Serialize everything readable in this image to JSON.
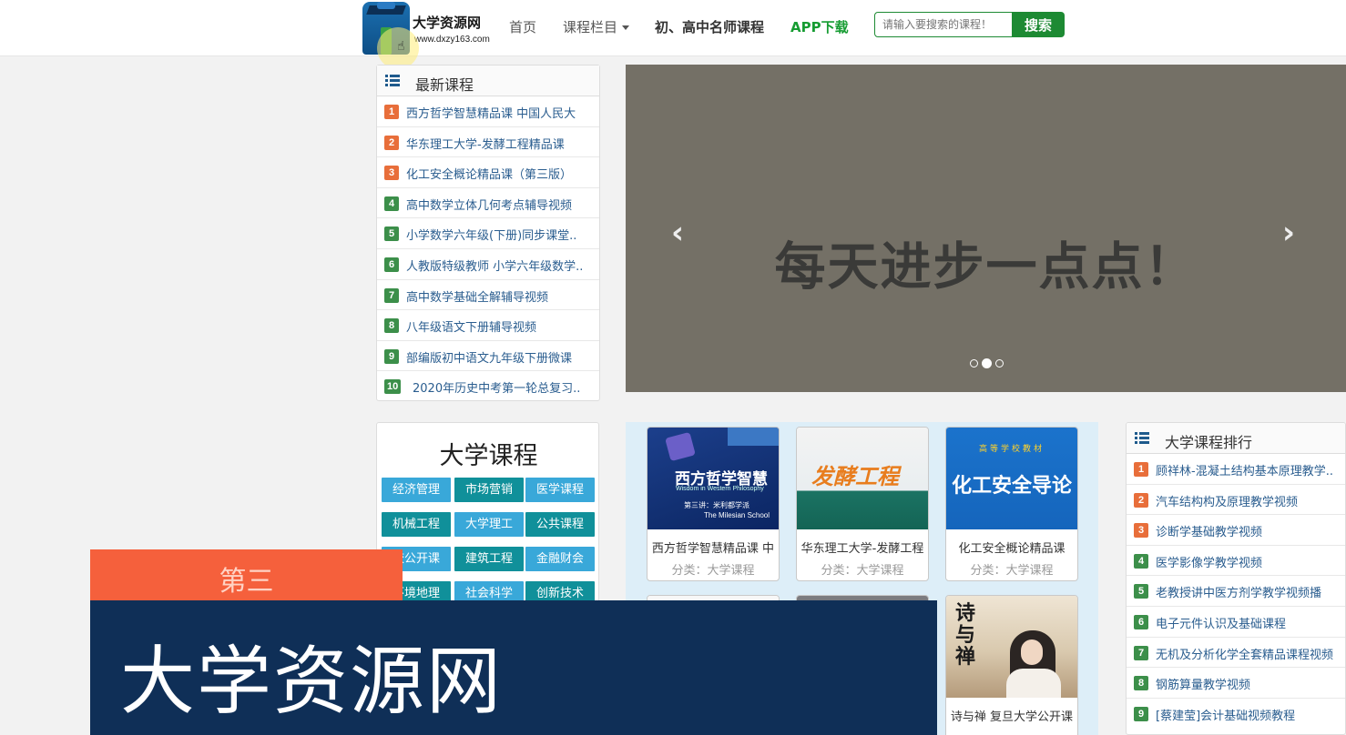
{
  "header": {
    "logo_title": "大学资源网",
    "logo_url": "www.dxzy163.com",
    "nav": [
      {
        "label": "首页"
      },
      {
        "label": "课程栏目"
      },
      {
        "label": "初、高中名师课程"
      },
      {
        "label": "APP下载"
      }
    ],
    "search_placeholder": "请输入要搜索的课程！",
    "search_button": "搜索"
  },
  "latest_courses": {
    "title": "最新课程",
    "items": [
      {
        "rank": "1",
        "label": "西方哲学智慧精品课 中国人民大"
      },
      {
        "rank": "2",
        "label": "华东理工大学-发酵工程精品课"
      },
      {
        "rank": "3",
        "label": "化工安全概论精品课（第三版）"
      },
      {
        "rank": "4",
        "label": "高中数学立体几何考点辅导视频"
      },
      {
        "rank": "5",
        "label": "小学数学六年级(下册)同步课堂.."
      },
      {
        "rank": "6",
        "label": "人教版特级教师 小学六年级数学.."
      },
      {
        "rank": "7",
        "label": "高中数学基础全解辅导视频"
      },
      {
        "rank": "8",
        "label": "八年级语文下册辅导视频"
      },
      {
        "rank": "9",
        "label": "部编版初中语文九年级下册微课"
      },
      {
        "rank": "10",
        "label": "2020年历史中考第一轮总复习.."
      }
    ]
  },
  "carousel": {
    "text": "每天进步一点点！",
    "prev": "‹",
    "next": "›",
    "active_index": 1,
    "slide_count": 3
  },
  "university": {
    "title": "大学课程",
    "categories": [
      "经济管理",
      "市场营销",
      "医学课程",
      "机械工程",
      "大学理工",
      "公共课程",
      "校公开课",
      "建筑工程",
      "金融财会",
      "环境地理",
      "社会科学",
      "创新技术"
    ]
  },
  "courses": [
    {
      "title": "西方哲学智慧精品课 中",
      "category": "分类：大学课程",
      "cover_main": "西方哲学智慧",
      "cover_en": "Wisdom in Western Philosophy",
      "cover_sub": "第三讲：米利都学派",
      "cover_sub2": "The Milesian School"
    },
    {
      "title": "华东理工大学-发酵工程",
      "category": "分类：大学课程",
      "cover_main": "发酵工程"
    },
    {
      "title": "化工安全概论精品课",
      "category": "分类：大学课程",
      "cover_top": "高等学校教材",
      "cover_main": "化工安全导论"
    },
    {
      "title": "",
      "category": ""
    },
    {
      "title": "",
      "category": ""
    },
    {
      "title": "诗与禅 复旦大学公开课",
      "category": "",
      "cover_main": "诗与禅"
    }
  ],
  "university_rank": {
    "title": "大学课程排行",
    "items": [
      {
        "rank": "1",
        "label": "顾祥林-混凝土结构基本原理教学.."
      },
      {
        "rank": "2",
        "label": "汽车结构构及原理教学视频"
      },
      {
        "rank": "3",
        "label": "诊断学基础教学视频"
      },
      {
        "rank": "4",
        "label": "医学影像学教学视频"
      },
      {
        "rank": "5",
        "label": "老教授讲中医方剂学教学视频播"
      },
      {
        "rank": "6",
        "label": "电子元件认识及基础课程"
      },
      {
        "rank": "7",
        "label": "无机及分析化学全套精品课程视频"
      },
      {
        "rank": "8",
        "label": "钢筋算量教学视频"
      },
      {
        "rank": "9",
        "label": "[蔡建莹]会计基础视频教程"
      }
    ]
  },
  "overlay": {
    "tag": "第三",
    "title": "大学资源网"
  },
  "colors": {
    "brand_green": "#1d8a33",
    "badge_orange": "#e86e3a",
    "badge_green": "#3c8f4a",
    "overlay_orange": "#f5603c",
    "overlay_navy": "#0f2f57",
    "category_blue": "#39a8d9",
    "category_teal": "#10909a"
  }
}
